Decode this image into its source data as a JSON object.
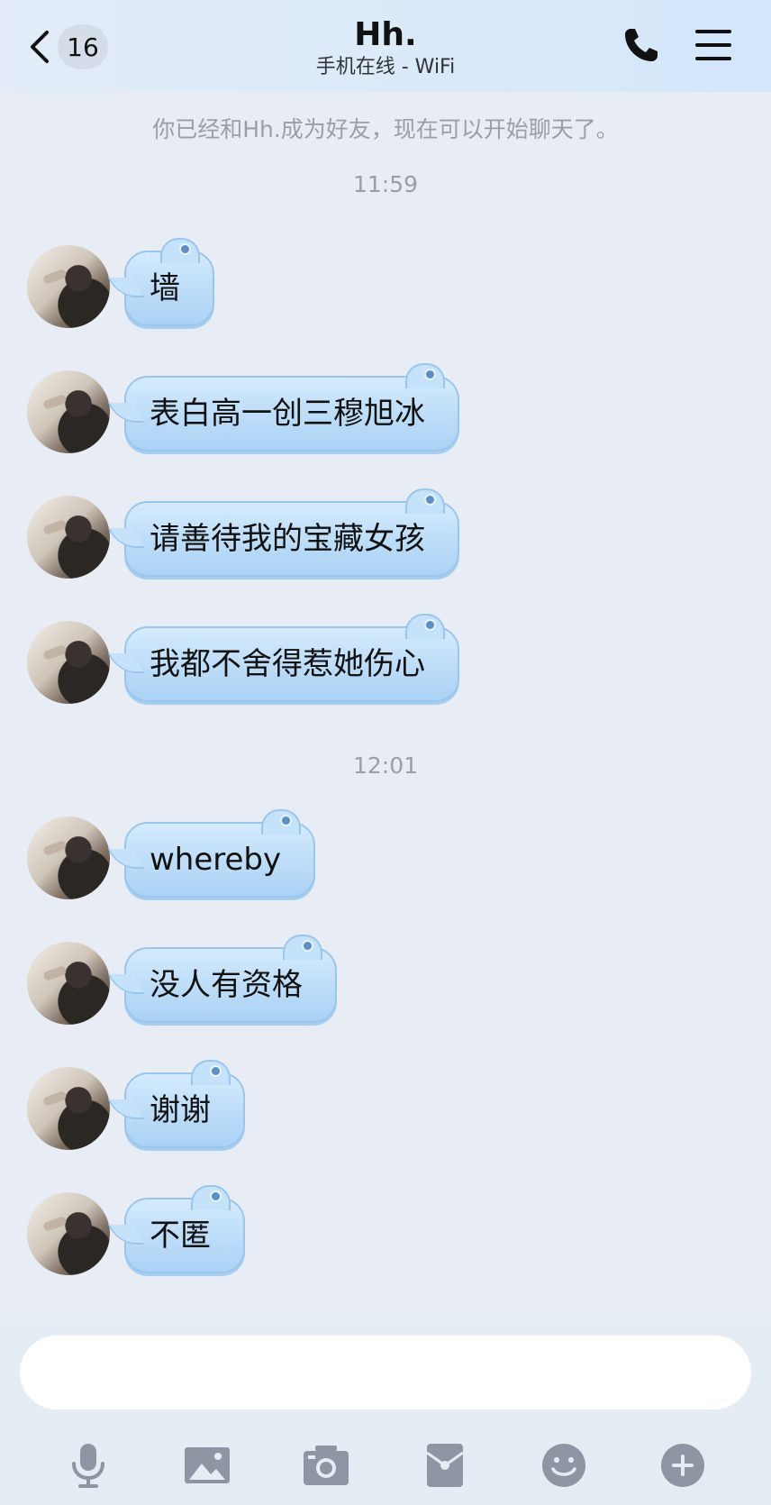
{
  "header": {
    "back_count": "16",
    "title": "Hh.",
    "subtitle": "手机在线 - WiFi"
  },
  "system_note": "你已经和Hh.成为好友，现在可以开始聊天了。",
  "timestamps": [
    "11:59",
    "12:01"
  ],
  "messages": [
    {
      "text": "墙"
    },
    {
      "text": "表白高一创三穆旭冰"
    },
    {
      "text": "请善待我的宝藏女孩"
    },
    {
      "text": "我都不舍得惹她伤心"
    },
    {
      "text": "whereby"
    },
    {
      "text": "没人有资格"
    },
    {
      "text": "谢谢"
    },
    {
      "text": "不匿"
    }
  ],
  "input": {
    "value": "",
    "placeholder": ""
  },
  "toolbar_icons": [
    "microphone-icon",
    "image-icon",
    "camera-icon",
    "red-packet-icon",
    "emoji-icon",
    "plus-icon"
  ],
  "colors": {
    "background": "#e8edf5",
    "bubble": "#c0defa",
    "icon_gray": "#8e96a3"
  }
}
